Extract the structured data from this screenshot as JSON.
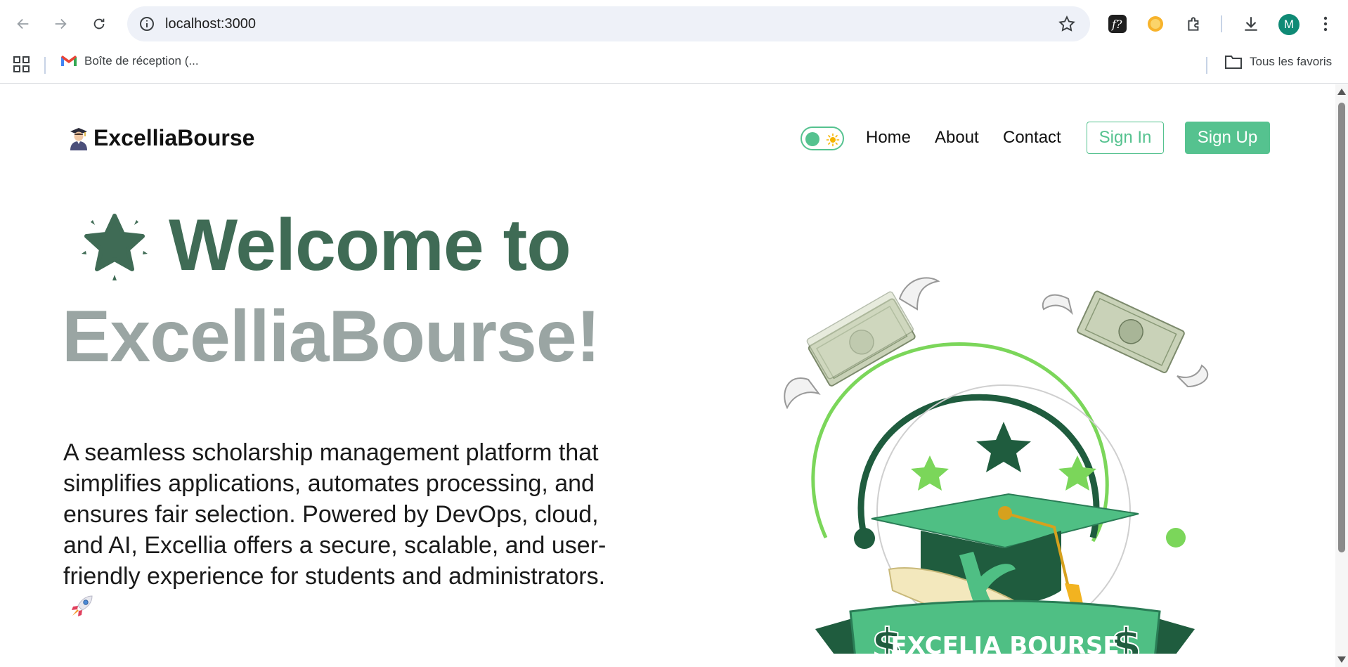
{
  "browser": {
    "url": "localhost:3000",
    "avatar_letter": "M",
    "bookmark_gmail": "Boîte de réception (...",
    "bookmark_all": "Tous les favoris"
  },
  "page": {
    "brand": "ExcelliaBourse",
    "nav": {
      "home": "Home",
      "about": "About",
      "contact": "Contact",
      "sign_in": "Sign In",
      "sign_up": "Sign Up"
    },
    "hero": {
      "line1": "Welcome to",
      "line2": "ExcelliaBourse!",
      "description": "A seamless scholarship management platform that simplifies applications, automates processing, and ensures fair selection. Powered by DevOps, cloud, and AI, Excellia offers a secure, scalable, and user-friendly experience for students and administrators."
    },
    "logo_banner": "EXCELIA BOURSE",
    "colors": {
      "accent": "#55c28f",
      "heading_dark": "#3f6b55",
      "heading_light": "#9aa5a3"
    }
  }
}
